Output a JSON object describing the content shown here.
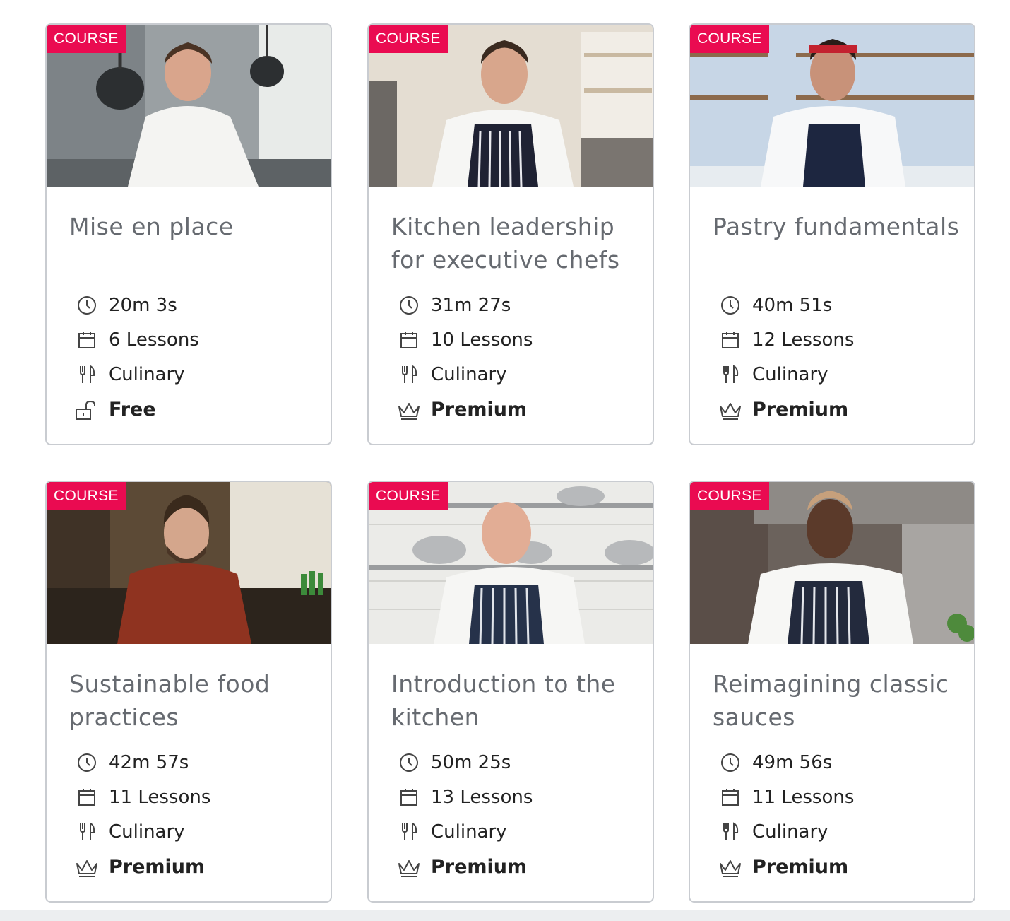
{
  "colors": {
    "badge": "#ea0b51",
    "title_text": "#666a70",
    "meta_text": "#222222",
    "card_border": "#c9ccd1"
  },
  "courses": [
    {
      "badge": "COURSE",
      "title": "Mise en place",
      "duration": "20m 3s",
      "lessons": "6 Lessons",
      "category": "Culinary",
      "access": "Free",
      "access_icon": "unlock-icon",
      "image": "chef in white jacket, stainless kitchen with hanging pans"
    },
    {
      "badge": "COURSE",
      "title": "Kitchen leadership for executive chefs",
      "duration": "31m 27s",
      "lessons": "10 Lessons",
      "category": "Culinary",
      "access": "Premium",
      "access_icon": "crown-icon",
      "image": "chef in striped apron, bright kitchen with shelves"
    },
    {
      "badge": "COURSE",
      "title": "Pastry fundamentals",
      "duration": "40m 51s",
      "lessons": "12 Lessons",
      "category": "Culinary",
      "access": "Premium",
      "access_icon": "crown-icon",
      "image": "chef with red headband, blue tiled kitchen"
    },
    {
      "badge": "COURSE",
      "title": "Sustainable food practices",
      "duration": "42m 57s",
      "lessons": "11 Lessons",
      "category": "Culinary",
      "access": "Premium",
      "access_icon": "crown-icon",
      "image": "bearded man in red shirt, restaurant bar"
    },
    {
      "badge": "COURSE",
      "title": "Introduction to the kitchen",
      "duration": "50m 25s",
      "lessons": "13 Lessons",
      "category": "Culinary",
      "access": "Premium",
      "access_icon": "crown-icon",
      "image": "chef in apron, white tiles with steel bowls"
    },
    {
      "badge": "COURSE",
      "title": "Reimagining classic sauces",
      "duration": "49m 56s",
      "lessons": "11 Lessons",
      "category": "Culinary",
      "access": "Premium",
      "access_icon": "crown-icon",
      "image": "smiling chef in striped apron, dark steel hood"
    }
  ]
}
